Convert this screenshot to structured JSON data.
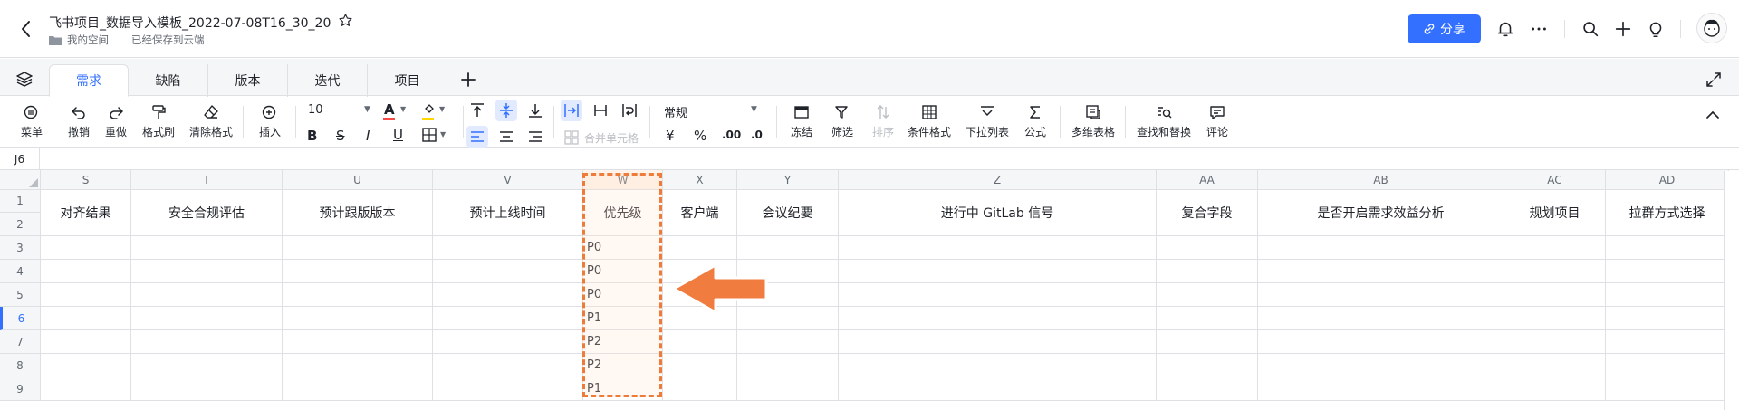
{
  "doc": {
    "title": "飞书项目_数据导入模板_2022-07-08T16_30_20",
    "location": "我的空间",
    "save_status": "已经保存到云端"
  },
  "header": {
    "share_label": "分享",
    "icons": [
      "back-icon",
      "star-icon",
      "link-icon",
      "bell-icon",
      "more-icon",
      "search-icon",
      "plus-icon",
      "lightbulb-icon",
      "avatar"
    ]
  },
  "tabs": [
    "需求",
    "缺陷",
    "版本",
    "迭代",
    "项目"
  ],
  "active_tab": "需求",
  "toolbar": {
    "menu": "菜单",
    "undo": "撤销",
    "redo": "重做",
    "format_painter": "格式刷",
    "clear_format": "清除格式",
    "insert": "插入",
    "font_size": "10",
    "merge_cells": "合并单元格",
    "number_format": "常规",
    "currency": "¥",
    "percent": "%",
    "decimal_add": ".00",
    "decimal_remove": ".0",
    "freeze": "冻结",
    "filter": "筛选",
    "sort": "排序",
    "conditional_format": "条件格式",
    "dropdown_list": "下拉列表",
    "formula": "公式",
    "multi_table": "多维表格",
    "find_replace": "查找和替换",
    "comment": "评论"
  },
  "formula_bar": {
    "cell_ref": "J6"
  },
  "grid": {
    "columns": [
      "S",
      "T",
      "U",
      "V",
      "W",
      "X",
      "Y",
      "Z",
      "AA",
      "AB",
      "AC",
      "AD"
    ],
    "row_numbers": [
      "1",
      "2",
      "3",
      "4",
      "5",
      "6",
      "7",
      "8",
      "9"
    ],
    "selected_row": "6",
    "headers": [
      "对齐结果",
      "安全合规评估",
      "预计跟版版本",
      "预计上线时间",
      "优先级",
      "客户端",
      "会议纪要",
      "进行中 GitLab 信号",
      "复合字段",
      "是否开启需求效益分析",
      "规划项目",
      "拉群方式选择"
    ],
    "priority_values": [
      "P0",
      "P0",
      "P0",
      "P1",
      "P2",
      "P2",
      "P1"
    ],
    "highlighted_column": "W",
    "highlight_color": "#ef7b3a"
  },
  "colors": {
    "accent": "#3370ff",
    "annotation": "#ef7b3a"
  }
}
